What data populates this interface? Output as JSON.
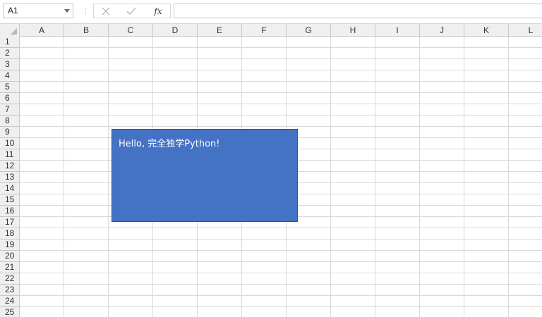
{
  "formula_bar": {
    "name_box_value": "A1",
    "separator": "⋮",
    "cancel_icon": "close-icon",
    "enter_icon": "checkmark-icon",
    "fx_label": "fx",
    "formula_value": ""
  },
  "sheet": {
    "columns": [
      "A",
      "B",
      "C",
      "D",
      "E",
      "F",
      "G",
      "H",
      "I",
      "J",
      "K",
      "L"
    ],
    "rows": [
      "1",
      "2",
      "3",
      "4",
      "5",
      "6",
      "7",
      "8",
      "9",
      "10",
      "11",
      "12",
      "13",
      "14",
      "15",
      "16",
      "17",
      "18",
      "19",
      "20",
      "21",
      "22",
      "23",
      "24",
      "25"
    ],
    "gridline_color": "#d9d9d9",
    "header_bg": "#efefef"
  },
  "shape": {
    "text": "Hello, 完全独学Python!",
    "fill_color": "#4472c4",
    "border_color": "#2f528f",
    "text_color": "#ffffff"
  }
}
